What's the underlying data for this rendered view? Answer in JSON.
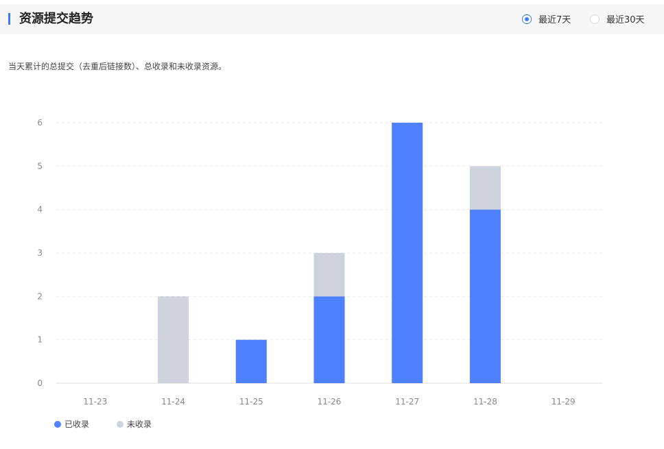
{
  "header": {
    "title": "资源提交趋势",
    "ranges": [
      {
        "label": "最近7天",
        "selected": true
      },
      {
        "label": "最近30天",
        "selected": false
      }
    ]
  },
  "description": "当天累计的总提交（去重后链接数）、总收录和未收录资源。",
  "colors": {
    "accent": "#3f7bfa",
    "indexed": "#4e80ff",
    "not_indexed": "#cfd3db"
  },
  "chart_data": {
    "type": "bar",
    "stacked": true,
    "categories": [
      "11-23",
      "11-24",
      "11-25",
      "11-26",
      "11-27",
      "11-28",
      "11-29"
    ],
    "series": [
      {
        "name": "已收录",
        "color": "#4e80ff",
        "values": [
          0,
          0,
          1,
          2,
          6,
          4,
          0
        ]
      },
      {
        "name": "未收录",
        "color": "#cfd3db",
        "values": [
          0,
          2,
          0,
          1,
          0,
          1,
          0
        ]
      }
    ],
    "yticks": [
      0,
      1,
      2,
      3,
      4,
      5,
      6
    ],
    "ylim": [
      0,
      6
    ],
    "grid": true,
    "legend_position": "bottom-left"
  }
}
